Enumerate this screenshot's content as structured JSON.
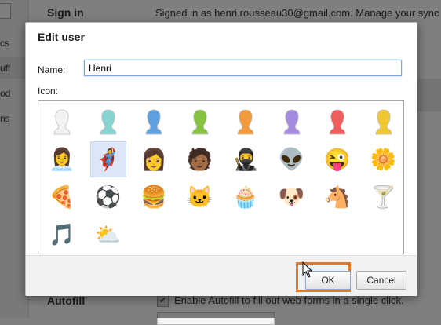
{
  "background": {
    "sidebar_labels": [
      "cs",
      "uff",
      "od",
      "ns"
    ],
    "signin_heading": "Sign in",
    "signin_text": "Signed in as henri.rousseau30@gmail.com. Manage your sync",
    "autofill_heading": "Autofill",
    "autofill_text": "Enable Autofill to fill out web forms in a single click."
  },
  "dialog": {
    "title": "Edit user",
    "name_label": "Name:",
    "name_value": "Henri",
    "icon_label": "Icon:",
    "selected_icon_index": 9,
    "icons": [
      {
        "name": "silhouette-white-icon",
        "color": "#f2f2f2"
      },
      {
        "name": "silhouette-teal-icon",
        "color": "#86d3cf"
      },
      {
        "name": "silhouette-blue-icon",
        "color": "#5e9fe0"
      },
      {
        "name": "silhouette-green-icon",
        "color": "#87c343"
      },
      {
        "name": "silhouette-orange-icon",
        "color": "#f39b3c"
      },
      {
        "name": "silhouette-purple-icon",
        "color": "#a58be0"
      },
      {
        "name": "silhouette-red-icon",
        "color": "#ef5d5d"
      },
      {
        "name": "silhouette-yellow-icon",
        "color": "#f0c72f"
      },
      {
        "name": "businesswoman-icon",
        "glyph": "👩‍💼"
      },
      {
        "name": "superhero-icon",
        "glyph": "🦸"
      },
      {
        "name": "woman-sunglasses-icon",
        "glyph": "👩"
      },
      {
        "name": "man-suit-icon",
        "glyph": "🧑🏾"
      },
      {
        "name": "ninja-icon",
        "glyph": "🥷"
      },
      {
        "name": "alien-icon",
        "glyph": "👽"
      },
      {
        "name": "smiley-face-icon",
        "glyph": "😜"
      },
      {
        "name": "flower-icon",
        "glyph": "🌼"
      },
      {
        "name": "pizza-icon",
        "glyph": "🍕"
      },
      {
        "name": "soccer-ball-icon",
        "glyph": "⚽"
      },
      {
        "name": "burger-icon",
        "glyph": "🍔"
      },
      {
        "name": "cat-icon",
        "glyph": "🐱"
      },
      {
        "name": "cupcake-icon",
        "glyph": "🧁"
      },
      {
        "name": "dog-icon",
        "glyph": "🐶"
      },
      {
        "name": "horse-icon",
        "glyph": "🐴"
      },
      {
        "name": "cocktail-icon",
        "glyph": "🍸"
      },
      {
        "name": "music-note-icon",
        "glyph": "🎵"
      },
      {
        "name": "sun-cloud-icon",
        "glyph": "⛅"
      }
    ],
    "ok_label": "OK",
    "cancel_label": "Cancel"
  },
  "colors": {
    "highlight": "#e07a2c",
    "input_focus": "#7da8e3"
  }
}
